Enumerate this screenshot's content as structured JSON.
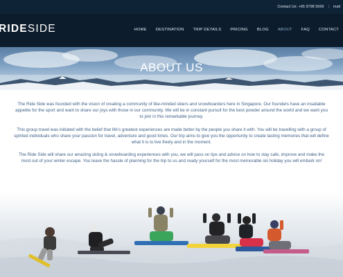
{
  "topbar": {
    "contact": "Contact Us: +65 9798 5669",
    "separator": "|",
    "email_fragment": "mail"
  },
  "logo": {
    "bold": "RIDE",
    "thin": "SIDE"
  },
  "nav": {
    "items": [
      {
        "label": "HOME"
      },
      {
        "label": "DESTINATION"
      },
      {
        "label": "TRIP DETAILS"
      },
      {
        "label": "PRICING"
      },
      {
        "label": "BLOG"
      },
      {
        "label": "ABOUT",
        "active": true
      },
      {
        "label": "FAQ"
      },
      {
        "label": "CONTACT"
      }
    ]
  },
  "hero": {
    "title": "ABOUT US"
  },
  "content": {
    "p1": "The Ride Side was founded with the vision of creating a community of like-minded skiers and snowboarders here in Singapore. Our founders have an insatiable appetite for the sport and want to share our joys with those in our community. We will be in constant pursuit for the best powder around the world and we want you to join in this remarkable journey.",
    "p2": "This group travel was initiated with the belief that life's greatest experiences are made better by the people you share it with. You will be travelling with a group of spirited individuals who share your passion for travel, adventure and good times. Our trip aims to give you the opportunity to create lasting memories that will define what it is to live freely and in the moment.",
    "p3": "The Ride Side will share our amazing skiing & snowboarding experiences with you, we will pass on tips and advice on how to stay safe, improve and make the most out of your winter escape. You leave the hassle of planning for the trip to us and ready yourself for the most memorable ski holiday you will embark on!"
  },
  "colors": {
    "topbar_bg": "#0f2337",
    "header_bg": "#0d1c2c",
    "body_text": "#3d5f86",
    "nav_active": "#8fb2cf"
  }
}
